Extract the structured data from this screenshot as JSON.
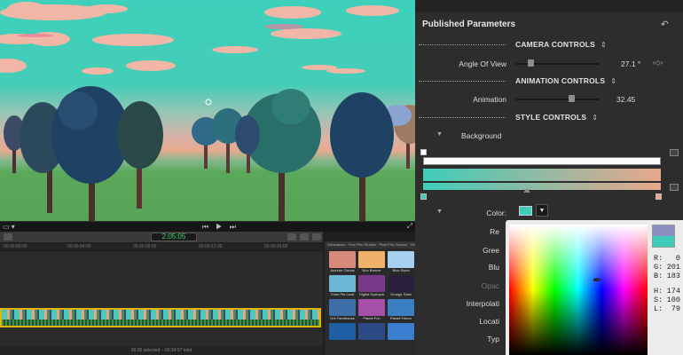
{
  "viewer": {
    "timecode": "2:05:05",
    "left_control": "▭ ▾",
    "playback": "⏮ ▶ ⏭",
    "fullscreen": "⤢"
  },
  "timeline": {
    "timecode": "2:05:05",
    "ruler_labels": [
      "00:00:00:00",
      "00:00:04:00",
      "00:00:08:00",
      "00:00:12:00",
      "00:00:16:00"
    ],
    "status": "00:05 selected – 00:34:07 total"
  },
  "generators": {
    "header": "Generators · Free Film Studies · Pixel Film Studios · RedDog Saas",
    "items": [
      {
        "label": "Autumn Clouds",
        "color": "#d88a7a"
      },
      {
        "label": "Boo Breeze",
        "color": "#f0b26a"
      },
      {
        "label": "Blue Skies",
        "color": "#a7d0ef"
      },
      {
        "label": "Cube Pin Land",
        "color": "#6cb7d6"
      },
      {
        "label": "Digital Dystopia",
        "color": "#7a3a8a"
      },
      {
        "label": "Grunge Town",
        "color": "#2a1f3a"
      },
      {
        "label": "Gnt Farmhouse",
        "color": "#3e6ea8"
      },
      {
        "label": "Planet Fun",
        "color": "#a54fa8"
      },
      {
        "label": "Planet Future",
        "color": "#3b7fc2"
      },
      {
        "label": "",
        "color": "#1e5ea4"
      },
      {
        "label": "",
        "color": "#2c4a86"
      },
      {
        "label": "",
        "color": "#3a7ecf"
      }
    ]
  },
  "inspector": {
    "title": "Published Parameters",
    "undo_icon": "↶",
    "sections": {
      "camera": "CAMERA CONTROLS",
      "animation": "ANIMATION CONTROLS",
      "style": "STYLE CONTROLS"
    },
    "angle_of_view": {
      "label": "Angle Of View",
      "value": "27.1",
      "unit": "°",
      "level": 0.18
    },
    "animation_param": {
      "label": "Animation",
      "value": "32.45",
      "level": 0.66
    },
    "background_label": "Background",
    "color_label": "Color:",
    "partial_labels": [
      "Re",
      "Gree",
      "Blu",
      "Opac",
      "Interpolati",
      "Locati",
      "Typ"
    ],
    "updown": "⇕",
    "disclosure": "▼",
    "keyframe_nav": "‹◇›"
  },
  "picker": {
    "R": "0",
    "G": "201",
    "B": "183",
    "H": "174",
    "S": "100",
    "L": "79",
    "accent_color": "#3fcdb9"
  }
}
